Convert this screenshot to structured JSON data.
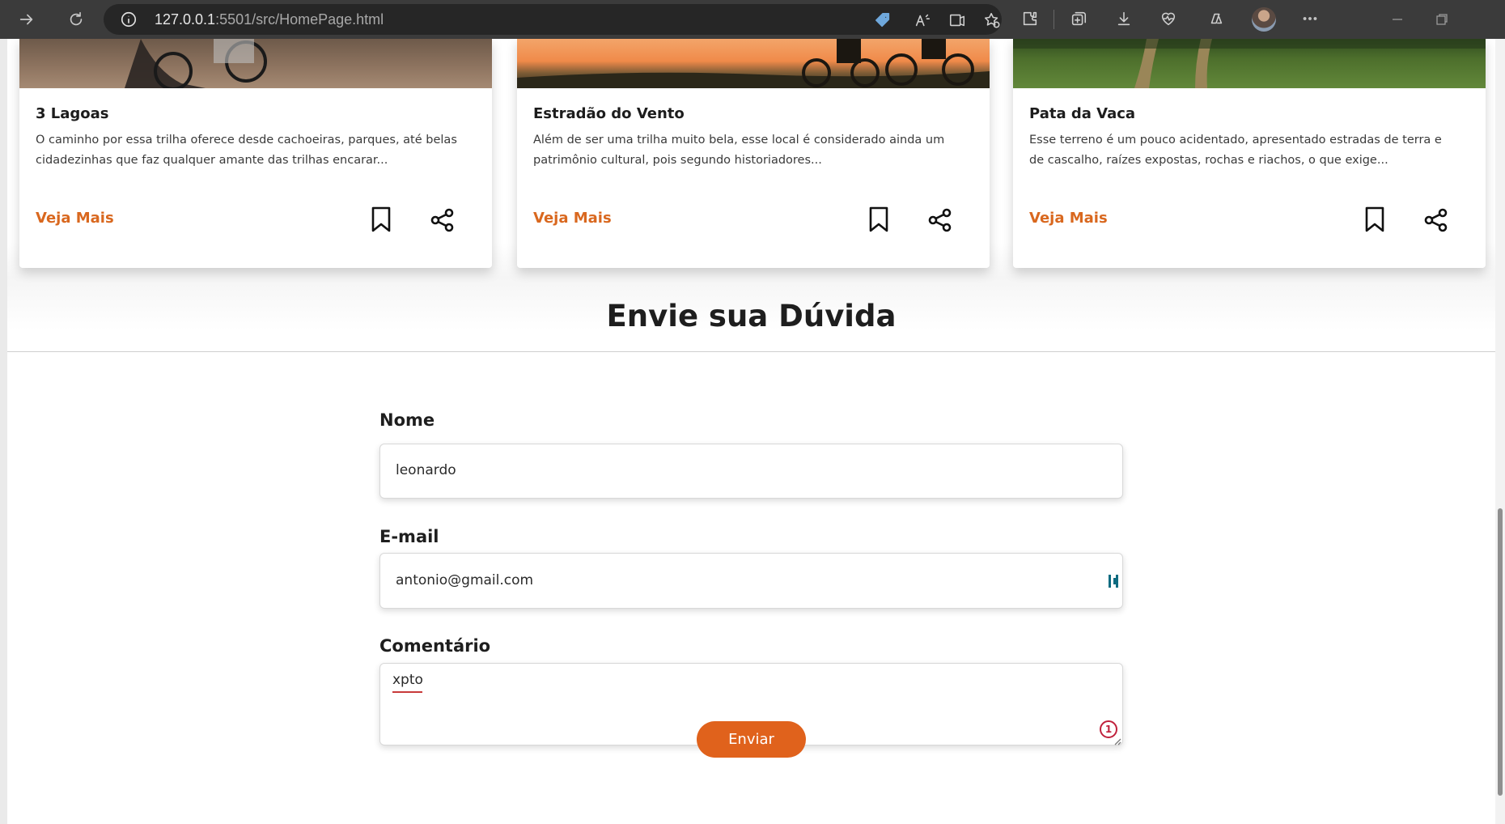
{
  "browser": {
    "url_host": "127.0.0.1",
    "url_path": ":5501/src/HomePage.html",
    "icons": [
      "forward-icon",
      "refresh-icon",
      "site-info-icon",
      "coupon-tag-icon",
      "read-aloud-icon",
      "immersive-reader-icon",
      "add-favorite-icon",
      "extensions-icon",
      "collections-icon",
      "downloads-icon",
      "browser-essentials-icon",
      "copilot-icon",
      "profile-avatar",
      "more-options-icon",
      "minimize-icon",
      "restore-icon"
    ]
  },
  "cards": [
    {
      "title": "3 Lagoas",
      "description": "O caminho por essa trilha oferece desde cachoeiras, parques, até belas cidadezinhas que faz qualquer amante das trilhas encarar...",
      "link_label": "Veja Mais"
    },
    {
      "title": "Estradão do Vento",
      "description": "Além de ser uma trilha muito bela, esse local é considerado ainda um patrimônio cultural, pois segundo historiadores...",
      "link_label": "Veja Mais"
    },
    {
      "title": "Pata da Vaca",
      "description": "Esse terreno é um pouco acidentado, apresentado estradas de terra e de cascalho, raízes expostas, rochas e riachos, o que exige...",
      "link_label": "Veja Mais"
    }
  ],
  "form": {
    "title": "Envie sua Dúvida",
    "name_label": "Nome",
    "name_value": "leonardo",
    "email_label": "E-mail",
    "email_value": "antonio@gmail.com",
    "comment_label": "Comentário",
    "comment_value": "xpto",
    "spelling_badge": "1",
    "submit_label": "Enviar"
  },
  "colors": {
    "accent": "#e0621c",
    "link": "#d9681f",
    "chrome_bg": "#3b3b3b"
  }
}
